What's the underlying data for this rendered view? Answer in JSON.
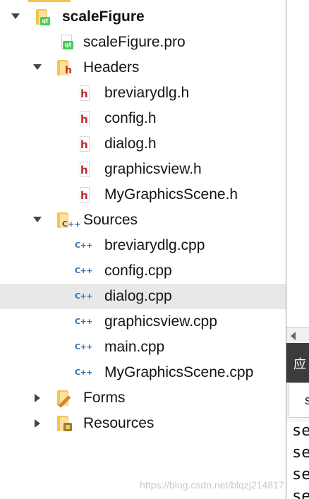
{
  "project": {
    "name": "scaleFigure",
    "pro_file": "scaleFigure.pro",
    "folders": {
      "headers": {
        "label": "Headers",
        "files": [
          "breviarydlg.h",
          "config.h",
          "dialog.h",
          "graphicsview.h",
          "MyGraphicsScene.h"
        ]
      },
      "sources": {
        "label": "Sources",
        "files": [
          "breviarydlg.cpp",
          "config.cpp",
          "dialog.cpp",
          "graphicsview.cpp",
          "main.cpp",
          "MyGraphicsScene.cpp"
        ]
      },
      "forms": {
        "label": "Forms"
      },
      "resources": {
        "label": "Resources"
      }
    },
    "selected_file": "dialog.cpp"
  },
  "right_panel": {
    "header_text": "应",
    "tab_text": "s",
    "code_lines": [
      "se",
      "se",
      "se",
      "se"
    ]
  },
  "watermark": "https://blog.csdn.net/blqzj214817",
  "icons": {
    "project": "qt-project-folder-icon",
    "pro": "qt-pro-file-icon",
    "headers": "headers-folder-icon",
    "header_file": "header-file-icon",
    "sources": "sources-folder-icon",
    "cpp_file": "cpp-file-icon",
    "forms": "forms-folder-icon",
    "resources": "resources-folder-icon"
  },
  "colors": {
    "qt_green": "#41cd52",
    "header_red": "#c3282d",
    "cpp_blue": "#2e6cb5",
    "folder_yellow": "#f4c452",
    "selection": "#e8e8e8"
  }
}
